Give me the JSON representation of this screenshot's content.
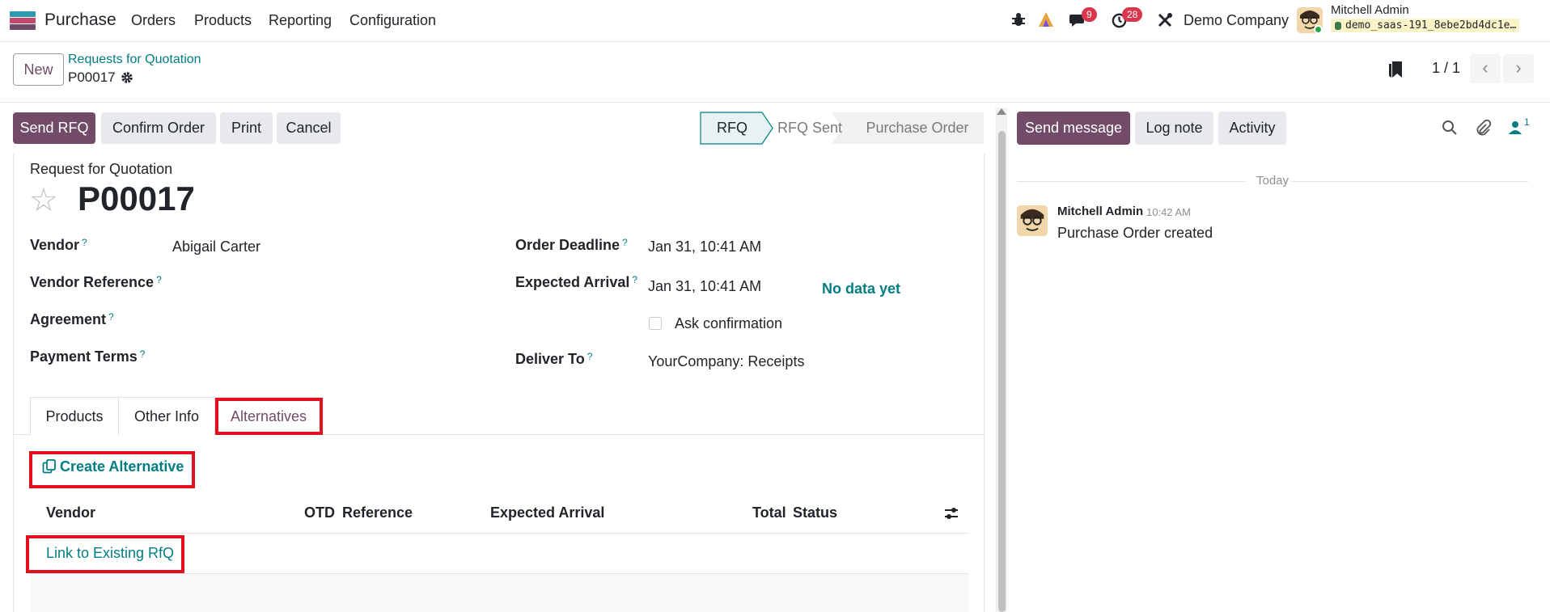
{
  "topnav": {
    "app_name": "Purchase",
    "menu": [
      "Orders",
      "Products",
      "Reporting",
      "Configuration"
    ],
    "messages_count": "9",
    "activities_count": "28",
    "company": "Demo Company",
    "user_name": "Mitchell Admin",
    "database": "demo_saas-191_8ebe2bd4dc1e…"
  },
  "control": {
    "new_label": "New",
    "breadcrumb_parent": "Requests for Quotation",
    "breadcrumb_current": "P00017",
    "pager": "1 / 1"
  },
  "actions": {
    "send_rfq": "Send RFQ",
    "confirm_order": "Confirm Order",
    "print": "Print",
    "cancel": "Cancel"
  },
  "stages": [
    "RFQ",
    "RFQ Sent",
    "Purchase Order"
  ],
  "form": {
    "doc_type": "Request for Quotation",
    "name": "P00017",
    "vendor_label": "Vendor",
    "vendor_value": "Abigail Carter",
    "vendor_ref_label": "Vendor Reference",
    "agreement_label": "Agreement",
    "payment_terms_label": "Payment Terms",
    "order_deadline_label": "Order Deadline",
    "order_deadline_value": "Jan 31, 10:41 AM",
    "expected_arrival_label": "Expected Arrival",
    "expected_arrival_value": "Jan 31, 10:41 AM",
    "no_data": "No data yet",
    "ask_confirmation": "Ask confirmation",
    "deliver_to_label": "Deliver To",
    "deliver_to_value": "YourCompany: Receipts",
    "help_mark": "?"
  },
  "tabs": [
    "Products",
    "Other Info",
    "Alternatives"
  ],
  "alternatives": {
    "create_label": "Create Alternative",
    "columns": [
      "Vendor",
      "OTD",
      "Reference",
      "Expected Arrival",
      "Total",
      "Status"
    ],
    "link_label": "Link to Existing RfQ"
  },
  "chatter": {
    "send_message": "Send message",
    "log_note": "Log note",
    "activity": "Activity",
    "followers_count": "1",
    "today": "Today",
    "author": "Mitchell Admin",
    "time": "10:42 AM",
    "body": "Purchase Order created"
  },
  "colors": {
    "primary": "#714b67",
    "link": "#017e84",
    "highlight": "#e0101f"
  }
}
